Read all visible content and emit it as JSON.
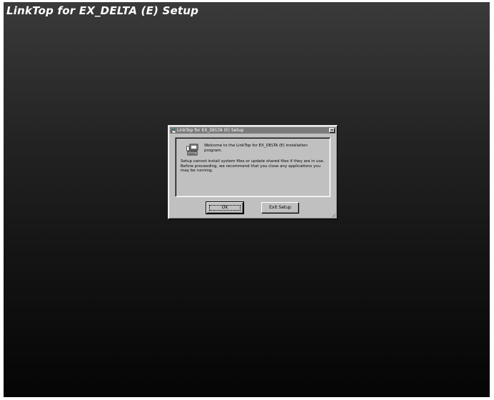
{
  "screen": {
    "banner_title": "LinkTop for EX_DELTA (E) Setup"
  },
  "dialog": {
    "title": "LinkTop for EX_DELTA (E) Setup",
    "close_glyph": "×",
    "icon": "computer-setup-icon",
    "welcome_text": "Welcome to the LinkTop for EX_DELTA (E) installation program.",
    "body_text": "Setup cannot install system files or update shared files if they are in use. Before proceeding, we recommend that you close any applications you may be running.",
    "buttons": {
      "ok_label": "OK",
      "exit_label": "Exit Setup"
    }
  },
  "colors": {
    "desktop_top": "#3a3a3a",
    "desktop_bottom": "#050505",
    "dialog_face": "#c0c0c0",
    "titlebar": "#7b7b7b"
  }
}
